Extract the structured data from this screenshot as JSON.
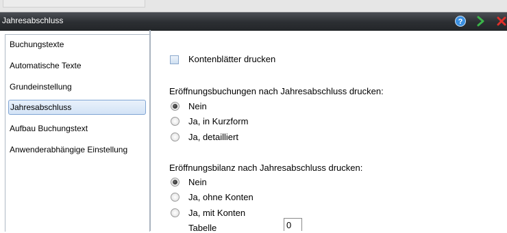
{
  "window": {
    "title": "Jahresabschluss",
    "icons": {
      "help": "help-icon",
      "next": "next-arrow-icon",
      "close": "close-icon"
    }
  },
  "sidebar": {
    "items": [
      {
        "label": "Buchungstexte"
      },
      {
        "label": "Automatische Texte"
      },
      {
        "label": "Grundeinstellung"
      },
      {
        "label": "Jahresabschluss",
        "selected": true
      },
      {
        "label": "Aufbau Buchungstext"
      },
      {
        "label": "Anwenderabhängige Einstellung"
      }
    ]
  },
  "main": {
    "checkbox_label": "Kontenblätter drucken",
    "checkbox_checked": false,
    "group1": {
      "heading": "Eröffnungsbuchungen nach Jahresabschluss drucken:",
      "options": [
        "Nein",
        "Ja, in Kurzform",
        "Ja, detailliert"
      ],
      "selected": "Nein"
    },
    "group2": {
      "heading": "Eröffnungsbilanz nach Jahresabschluss drucken:",
      "options": [
        "Nein",
        "Ja, ohne Konten",
        "Ja, mit Konten"
      ],
      "selected": "Nein"
    },
    "tabelle_label": "Tabelle",
    "tabelle_value": "0"
  },
  "colors": {
    "titlebar": "#2c2f33",
    "selected_item": "#d3e3f6",
    "help_icon": "#3a8fe0",
    "next_icon": "#3bb54a",
    "close_icon": "#e0302a"
  }
}
